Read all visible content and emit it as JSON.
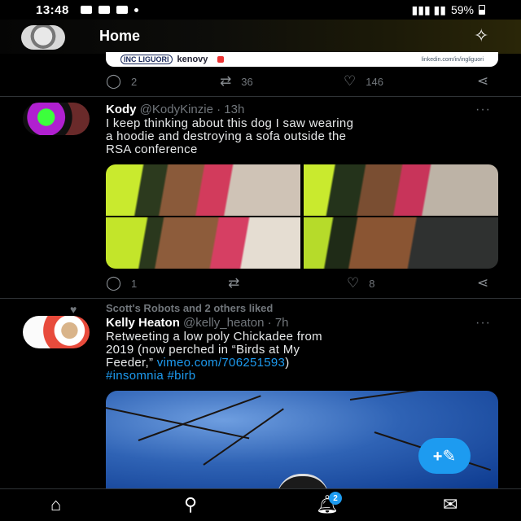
{
  "status_bar": {
    "time": "13:48",
    "battery": "59%"
  },
  "header": {
    "title": "Home"
  },
  "top_card": {
    "brand_left": "INC LIGUORI",
    "brand_right": "kenovy",
    "url_text": "linkedin.com/in/ingliguori"
  },
  "prev_actions": {
    "replies": "2",
    "retweets": "36",
    "likes": "146"
  },
  "tweet1": {
    "name": "Kody",
    "handle": "@KodyKinzie",
    "time": "· 13h",
    "more": "···",
    "text_line1": "I keep thinking about this dog I saw wearing",
    "text_line2": "a hoodie and destroying a sofa outside the",
    "text_line3": "RSA conference",
    "replies": "1",
    "retweets": "",
    "likes": "8"
  },
  "liked_context": "Scott's Robots and 2 others liked",
  "tweet2": {
    "name": "Kelly Heaton",
    "handle": "@kelly_heaton",
    "time": "· 7h",
    "more": "···",
    "text_line1": "Retweeting a low poly Chickadee from",
    "text_line2": "2019 (now perched in “Birds at My",
    "text_line3_prefix": "Feeder,”",
    "text_line3_link": "vimeo.com/706251593",
    "text_line3_suffix": ")",
    "hashtags": "#insomnia #birb"
  },
  "notifications_badge": "2",
  "icons": {
    "reply": "reply-icon",
    "retweet": "retweet-icon",
    "like": "heart-icon",
    "share": "share-icon",
    "sparkle": "sparkle-icon",
    "compose": "compose-feather-icon",
    "home": "home-icon",
    "search": "search-icon",
    "bell": "bell-icon",
    "mail": "mail-icon"
  },
  "colors": {
    "accent": "#1d9bf0",
    "background": "#000000",
    "muted": "#71767b"
  }
}
